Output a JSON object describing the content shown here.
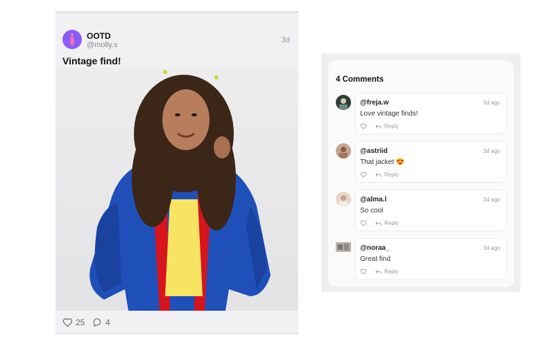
{
  "post": {
    "brand_name": "OOTD",
    "handle": "@molly.s",
    "age": "3d",
    "caption": "Vintage find!",
    "likes": "25",
    "comments": "4",
    "accent_color": "#8b5cf6"
  },
  "comments_panel": {
    "title": "4 Comments",
    "reply_label": "Reply",
    "items": [
      {
        "handle": "@freja.w",
        "time": "3d ago",
        "text": "Love vintage finds!"
      },
      {
        "handle": "@astriid",
        "time": "3d ago",
        "text": "That jacket 😍"
      },
      {
        "handle": "@alma.l",
        "time": "3d ago",
        "text": "So cool"
      },
      {
        "handle": "@noraa_",
        "time": "3d ago",
        "text": "Great find"
      }
    ]
  },
  "icons": {
    "like": "heart-icon",
    "comment": "speech-bubble-icon",
    "reply": "reply-arrow-icon"
  }
}
